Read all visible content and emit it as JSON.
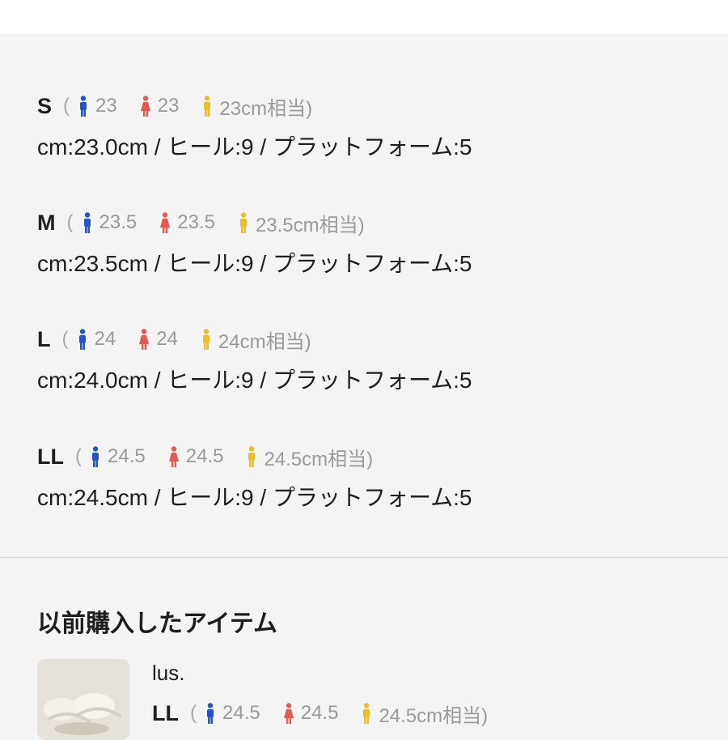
{
  "colors": {
    "male": "#2556c8",
    "female": "#e35a55",
    "unisex": "#ecbd2a"
  },
  "sizes": [
    {
      "label": "S",
      "male": "23",
      "female": "23",
      "unisex": "23cm相当)",
      "spec": "cm:23.0cm / ヒール:9 / プラットフォーム:5"
    },
    {
      "label": "M",
      "male": "23.5",
      "female": "23.5",
      "unisex": "23.5cm相当)",
      "spec": "cm:23.5cm / ヒール:9 / プラットフォーム:5"
    },
    {
      "label": "L",
      "male": "24",
      "female": "24",
      "unisex": "24cm相当)",
      "spec": "cm:24.0cm / ヒール:9 / プラットフォーム:5"
    },
    {
      "label": "LL",
      "male": "24.5",
      "female": "24.5",
      "unisex": "24.5cm相当)",
      "spec": "cm:24.5cm / ヒール:9 / プラットフォーム:5"
    }
  ],
  "paren_open": "(",
  "previous": {
    "title": "以前購入したアイテム",
    "item": {
      "brand": "lus.",
      "label": "LL",
      "male": "24.5",
      "female": "24.5",
      "unisex": "24.5cm相当)"
    }
  }
}
